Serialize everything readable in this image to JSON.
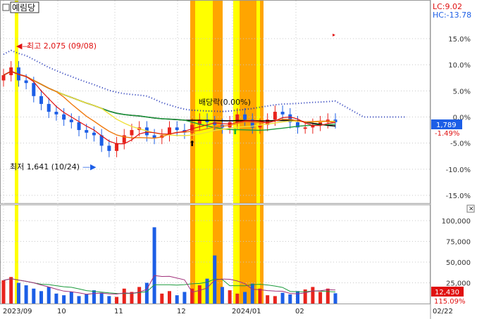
{
  "header": {
    "title": "예림당",
    "lc_label": "LC:9.02",
    "hc_label": "HC:-13.78",
    "checkbox_glyph": "□"
  },
  "annotations": {
    "high": "최고 2,075 (09/08)",
    "low": "최저 1,641 (10/24)",
    "dividend": "배당락(0.00%)"
  },
  "colors": {
    "up": "#e8231d",
    "down": "#1c5ee6",
    "highlight_yellow": "#ffff00",
    "highlight_orange": "#ffa500",
    "ma_black": "#000000",
    "ma_green": "#1b9a3c",
    "ma_yellow": "#f0e03a",
    "ma_orange": "#f07a10",
    "ma_red": "#e01010",
    "dotted_blue": "#1b2fb5",
    "badge_blue": "#1c5ee6",
    "badge_red": "#e01010"
  },
  "chart_data": [
    {
      "type": "line",
      "title": "",
      "x_labels": [
        "2023/09",
        "10",
        "11",
        "12",
        "2024/01",
        "02",
        "02/22"
      ],
      "y_ticks": [
        "15.0%",
        "10.0%",
        "5.0%",
        "0.0%",
        "-5.0%",
        "-10.0%",
        "-15.0%"
      ],
      "ylim": [
        -15.0,
        15.0
      ],
      "last_price": "1,789",
      "last_change": "-1.49%",
      "high_value": 2075,
      "low_value": 1641,
      "series": [
        {
          "values": [
            8.0,
            9.5,
            7.0,
            6.5,
            4.0,
            2.5,
            1.0,
            0.5,
            -0.5,
            -1.0,
            -2.5,
            -3.0,
            -3.5,
            -5.5,
            -6.5,
            -5.0,
            -3.5,
            -2.5,
            -2.0,
            -3.5,
            -4.0,
            -3.5,
            -2.0,
            -2.5,
            -3.0,
            -1.5,
            -0.5,
            -1.0,
            -1.5,
            -2.0,
            -1.0,
            0.5,
            -0.5,
            -2.0,
            -1.5,
            -0.5,
            1.0,
            0.5,
            -1.0,
            -2.0,
            -2.0,
            -1.5,
            -1.0,
            -0.5,
            -1.0
          ]
        }
      ]
    },
    {
      "type": "bar",
      "title": "",
      "y_ticks": [
        "100,000",
        "75,000",
        "50,000",
        "25,000"
      ],
      "ylim": [
        0,
        115000
      ],
      "last_volume": "12,430",
      "last_pct": "115.09%",
      "values": [
        28000,
        32000,
        25000,
        22000,
        18000,
        15000,
        20000,
        12000,
        10000,
        14000,
        9000,
        11000,
        16000,
        13000,
        9000,
        8000,
        18000,
        14000,
        20000,
        25000,
        92000,
        12000,
        15000,
        10000,
        14000,
        18000,
        22000,
        30000,
        58000,
        20000,
        16000,
        12000,
        14000,
        24000,
        18000,
        10000,
        9000,
        13000,
        11000,
        15000,
        17000,
        20000,
        14000,
        18000,
        12430
      ]
    }
  ]
}
